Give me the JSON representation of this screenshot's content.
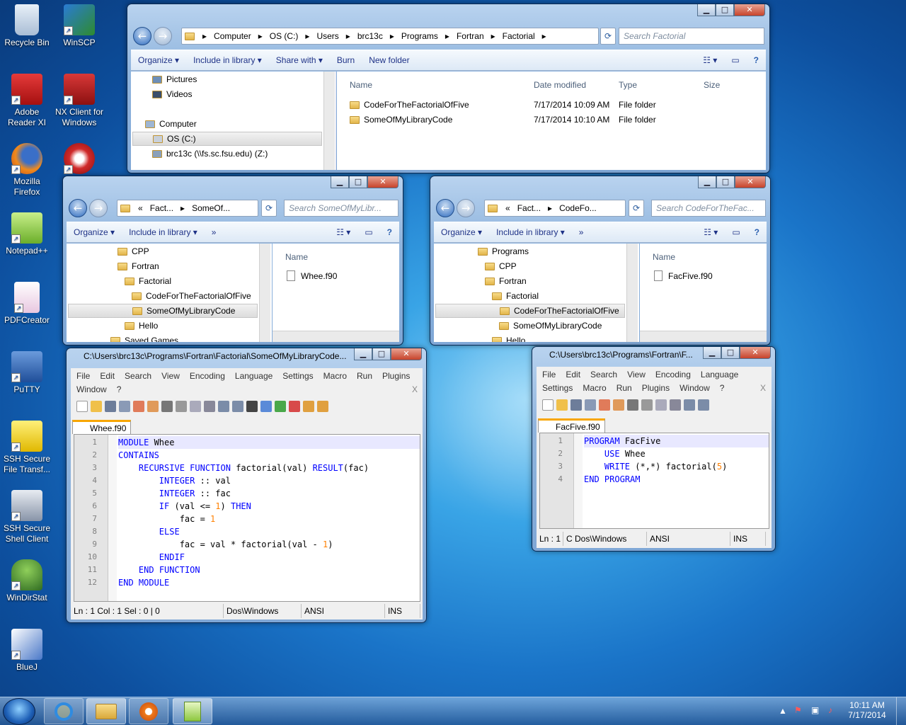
{
  "desktop": {
    "icons": [
      {
        "label": "Recycle Bin",
        "icon": "recycle-bin-icon",
        "color": "#b5c9df"
      },
      {
        "label": "WinSCP",
        "icon": "winscp-icon",
        "color": "#2e8b2e"
      },
      {
        "label": "Adobe Reader XI",
        "icon": "adobe-reader-icon",
        "color": "#d61f1f"
      },
      {
        "label": "NX Client for Windows",
        "icon": "nx-client-icon",
        "color": "#c82020"
      },
      {
        "label": "Mozilla Firefox",
        "icon": "firefox-icon",
        "color": "#e8711a"
      },
      {
        "label": "",
        "icon": "ccleaner-icon",
        "color": "#c62828"
      },
      {
        "label": "Notepad++",
        "icon": "notepadpp-icon",
        "color": "#8dc73f"
      },
      {
        "label": "PDFCreator",
        "icon": "pdfcreator-icon",
        "color": "#f0f0f0"
      },
      {
        "label": "PuTTY",
        "icon": "putty-icon",
        "color": "#3b6fc2"
      },
      {
        "label": "SSH Secure File Transf...",
        "icon": "ssh-file-transfer-icon",
        "color": "#f2d31b"
      },
      {
        "label": "SSH Secure Shell Client",
        "icon": "ssh-shell-icon",
        "color": "#9aa7b8"
      },
      {
        "label": "WinDirStat",
        "icon": "windirstat-icon",
        "color": "#4f8f3a"
      },
      {
        "label": "BlueJ",
        "icon": "bluej-icon",
        "color": "#3c6cb8"
      }
    ]
  },
  "explorer_main": {
    "breadcrumb": [
      "Computer",
      "OS (C:)",
      "Users",
      "brc13c",
      "Programs",
      "Fortran",
      "Factorial"
    ],
    "search_placeholder": "Search Factorial",
    "commands": [
      "Organize ▾",
      "Include in library ▾",
      "Share with ▾",
      "Burn",
      "New folder"
    ],
    "nav_items": [
      "Pictures",
      "Videos",
      "Computer",
      "OS (C:)",
      "brc13c (\\\\fs.sc.fsu.edu) (Z:)"
    ],
    "columns": [
      "Name",
      "Date modified",
      "Type",
      "Size"
    ],
    "files": [
      {
        "name": "CodeForTheFactorialOfFive",
        "date": "7/17/2014 10:09 AM",
        "type": "File folder"
      },
      {
        "name": "SomeOfMyLibraryCode",
        "date": "7/17/2014 10:10 AM",
        "type": "File folder"
      }
    ]
  },
  "explorer_left": {
    "breadcrumb": [
      "«",
      "Fact...",
      "SomeOf..."
    ],
    "search_placeholder": "Search SomeOfMyLibr...",
    "commands": [
      "Organize ▾",
      "Include in library ▾",
      "»"
    ],
    "tree": [
      "CPP",
      "Fortran",
      "Factorial",
      "CodeForTheFactorialOfFive",
      "SomeOfMyLibraryCode",
      "Hello",
      "Saved Games"
    ],
    "column": "Name",
    "files": [
      "Whee.f90"
    ]
  },
  "explorer_right": {
    "breadcrumb": [
      "«",
      "Fact...",
      "CodeFo..."
    ],
    "search_placeholder": "Search CodeForTheFac...",
    "commands": [
      "Organize ▾",
      "Include in library ▾",
      "»"
    ],
    "tree": [
      "Programs",
      "CPP",
      "Fortran",
      "Factorial",
      "CodeForTheFactorialOfFive",
      "SomeOfMyLibraryCode",
      "Hello"
    ],
    "column": "Name",
    "files": [
      "FacFive.f90"
    ]
  },
  "npp_left": {
    "title": "C:\\Users\\brc13c\\Programs\\Fortran\\Factorial\\SomeOfMyLibraryCode...",
    "menu_row1": [
      "File",
      "Edit",
      "Search",
      "View",
      "Encoding",
      "Language",
      "Settings",
      "Macro",
      "Run",
      "Plugins"
    ],
    "menu_row2": [
      "Window",
      "?"
    ],
    "close_x": "X",
    "tab": "Whee.f90",
    "lines": [
      "1",
      "2",
      "3",
      "4",
      "5",
      "6",
      "7",
      "8",
      "9",
      "10",
      "11",
      "12"
    ],
    "code": [
      "MODULE Whee",
      "CONTAINS",
      "    RECURSIVE FUNCTION factorial(val) RESULT(fac)",
      "        INTEGER :: val",
      "        INTEGER :: fac",
      "        IF (val <= 1) THEN",
      "            fac = 1",
      "        ELSE",
      "            fac = val * factorial(val - 1)",
      "        ENDIF",
      "    END FUNCTION",
      "END MODULE"
    ],
    "status": [
      "Ln : 1    Col : 1    Sel : 0 | 0",
      "Dos\\Windows",
      "ANSI",
      "INS"
    ]
  },
  "npp_right": {
    "title": "C:\\Users\\brc13c\\Programs\\Fortran\\F...",
    "menu_row1": [
      "File",
      "Edit",
      "Search",
      "View",
      "Encoding",
      "Language"
    ],
    "menu_row2": [
      "Settings",
      "Macro",
      "Run",
      "Plugins",
      "Window",
      "?"
    ],
    "close_x": "X",
    "tab": "FacFive.f90",
    "lines": [
      "1",
      "2",
      "3",
      "4"
    ],
    "code": [
      "PROGRAM FacFive",
      "    USE Whee",
      "    WRITE (*,*) factorial(5)",
      "END PROGRAM"
    ],
    "status": [
      "Ln : 1",
      "C Dos\\Windows",
      "ANSI",
      "INS"
    ]
  },
  "taskbar": {
    "clock_time": "10:11 AM",
    "clock_date": "7/17/2014",
    "apps": [
      "internet-explorer-icon",
      "windows-explorer-icon",
      "media-player-icon",
      "notepadpp-icon"
    ]
  }
}
